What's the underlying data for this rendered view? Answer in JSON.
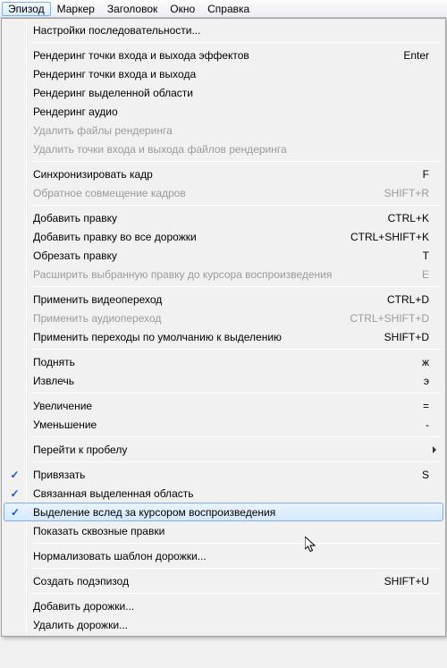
{
  "menubar": {
    "episode": "Эпизод",
    "marker": "Маркер",
    "header": "Заголовок",
    "window": "Окно",
    "help": "Справка"
  },
  "menu": {
    "sequence_settings": "Настройки последовательности...",
    "render_io_effects": "Рендеринг точки входа и выхода эффектов",
    "render_io_effects_sc": "Enter",
    "render_io": "Рендеринг точки входа и выхода",
    "render_selection": "Рендеринг выделенной области",
    "render_audio": "Рендеринг аудио",
    "delete_render_files": "Удалить файлы рендеринга",
    "delete_render_io": "Удалить точки входа и выхода файлов рендеринга",
    "match_frame": "Синхронизировать кадр",
    "match_frame_sc": "F",
    "reverse_match": "Обратное совмещение кадров",
    "reverse_match_sc": "SHIFT+R",
    "add_edit": "Добавить правку",
    "add_edit_sc": "CTRL+K",
    "add_edit_all": "Добавить правку во все дорожки",
    "add_edit_all_sc": "CTRL+SHIFT+K",
    "trim_edit": "Обрезать правку",
    "trim_edit_sc": "T",
    "extend_edit": "Расширить выбранную правку до курсора воспроизведения",
    "extend_edit_sc": "E",
    "apply_video_trans": "Применить видеопереход",
    "apply_video_trans_sc": "CTRL+D",
    "apply_audio_trans": "Применить аудиопереход",
    "apply_audio_trans_sc": "CTRL+SHIFT+D",
    "apply_default_trans": "Применить переходы по умолчанию к выделению",
    "apply_default_trans_sc": "SHIFT+D",
    "lift": "Поднять",
    "lift_sc": "ж",
    "extract": "Извлечь",
    "extract_sc": "э",
    "zoom_in": "Увеличение",
    "zoom_in_sc": "=",
    "zoom_out": "Уменьшение",
    "zoom_out_sc": "-",
    "go_to_gap": "Перейти к пробелу",
    "snap": "Привязать",
    "snap_sc": "S",
    "linked_selection": "Связанная выделенная область",
    "selection_follows": "Выделение вслед за курсором воспроизведения",
    "show_through": "Показать сквозные правки",
    "normalize_track": "Нормализовать шаблон дорожки...",
    "make_subsequence": "Создать подэпизод",
    "make_subsequence_sc": "SHIFT+U",
    "add_tracks": "Добавить дорожки...",
    "delete_tracks": "Удалить дорожки..."
  }
}
